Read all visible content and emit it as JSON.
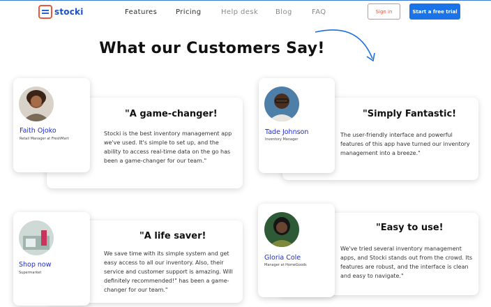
{
  "brand": {
    "name": "stocki"
  },
  "nav": {
    "items": [
      {
        "label": "Features"
      },
      {
        "label": "Pricing"
      },
      {
        "label": "Help desk"
      },
      {
        "label": "Blog"
      },
      {
        "label": "FAQ"
      }
    ]
  },
  "header": {
    "signin_label": "Sign in",
    "trial_label": "Start a free trial"
  },
  "section": {
    "title": "What our Customers Say!"
  },
  "testimonials": [
    {
      "headline": "\"A game-changer!",
      "body": "Stocki is the best inventory management app we've used. It's simple to set up, and the ability to access real-time data on the go has been a game-changer for our team.\"",
      "name": "Faith Ojoko",
      "role": "Retail Manager at FreshMart"
    },
    {
      "headline": "\"Simply Fantastic!",
      "body": "The user-friendly interface and powerful features of this app have turned our inventory management into a breeze.\"",
      "name": "Tade Johnson",
      "role": "Inventory Manager"
    },
    {
      "headline": "\"A life saver!",
      "body": "We save time with its simple system and get easy access to all our inventory. Also, their service and customer support is amazing. Will definitely recommended!\" has been a game-changer for our team.\"",
      "name": "Shop now",
      "role": "Supermarket"
    },
    {
      "headline": "\"Easy to use!",
      "body": "We've tried several inventory management apps, and Stocki stands out from the crowd. Its features are robust, and the interface is clean and easy to navigate.\"",
      "name": "Gloria Cole",
      "role": "Manager at HomeGoods"
    }
  ],
  "colors": {
    "accent": "#1a73e8",
    "name_link": "#1d2bd6",
    "signin_border": "#e98a7c",
    "logo_orange": "#e8583b"
  }
}
